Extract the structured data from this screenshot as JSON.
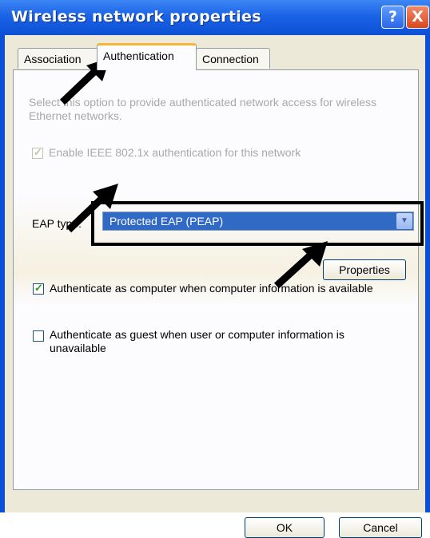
{
  "window": {
    "title": "Wireless network properties",
    "help_glyph": "?",
    "close_glyph": "X"
  },
  "tabs": [
    {
      "label": "Association"
    },
    {
      "label": "Authentication",
      "selected": true
    },
    {
      "label": "Connection"
    }
  ],
  "auth": {
    "description": "Select this option to provide authenticated network access for wireless Ethernet networks.",
    "enable_8021x": {
      "label": "Enable IEEE 802.1x authentication for this network",
      "checked": true,
      "enabled": false
    },
    "eap_type_label": "EAP type:",
    "eap_type_value": "Protected EAP (PEAP)",
    "properties_label": "Properties",
    "auth_computer": {
      "label": "Authenticate as computer when computer information is available",
      "checked": true
    },
    "auth_guest": {
      "label": "Authenticate as guest when user or computer information is unavailable",
      "checked": false
    }
  },
  "footer": {
    "ok_label": "OK",
    "cancel_label": "Cancel"
  },
  "colors": {
    "title_bar": "#1a63e6",
    "selection": "#316ac5",
    "tab_accent": "#f5b63a",
    "dialog_bg": "#ece9d8"
  }
}
